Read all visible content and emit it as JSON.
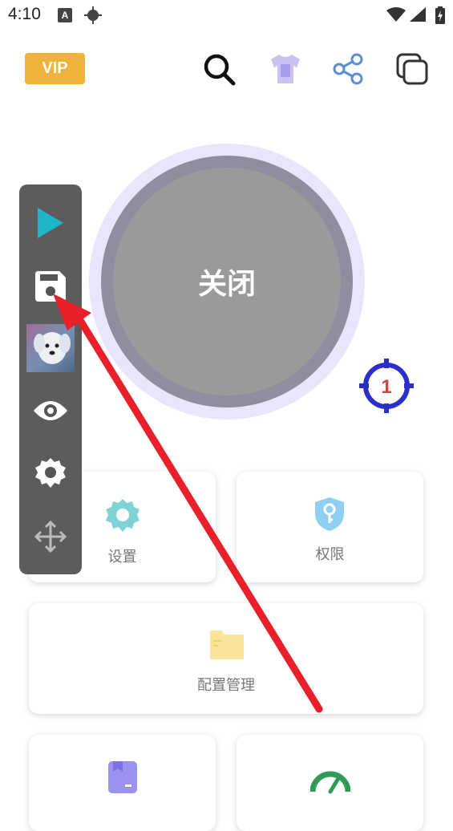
{
  "status_bar": {
    "time": "4:10",
    "notification_letter": "A",
    "icons": [
      "a-notification-icon",
      "crosshair-status-icon",
      "wifi-icon",
      "signal-icon",
      "battery-charging-icon"
    ]
  },
  "header": {
    "vip_label": "VIP",
    "icons": [
      "search-icon",
      "tshirt-icon",
      "share-icon",
      "copy-windows-icon"
    ]
  },
  "power_button": {
    "label": "关闭"
  },
  "target_badge": {
    "count": "1"
  },
  "cards": {
    "settings": {
      "label": "设置"
    },
    "permissions": {
      "label": "权限"
    },
    "config_manage": {
      "label": "配置管理"
    },
    "bottom_left": {
      "label": ""
    },
    "bottom_right": {
      "label": ""
    }
  },
  "floating_toolbar": {
    "items": [
      "play-icon",
      "save-icon",
      "thumbnail-image",
      "eye-icon",
      "gear-icon",
      "move-icon"
    ]
  },
  "colors": {
    "vip": "#f0b33a",
    "play": "#1fb6c9",
    "arrow": "#e8202a",
    "target": "#2b2fc7",
    "target_number": "#e23b3b",
    "settings_icon": "#7fd3d3",
    "permission_icon": "#8fd0f2",
    "folder_icon": "#fbe39a",
    "bookmark_icon": "#9b91ee",
    "gauge_icon": "#2f9b56"
  }
}
